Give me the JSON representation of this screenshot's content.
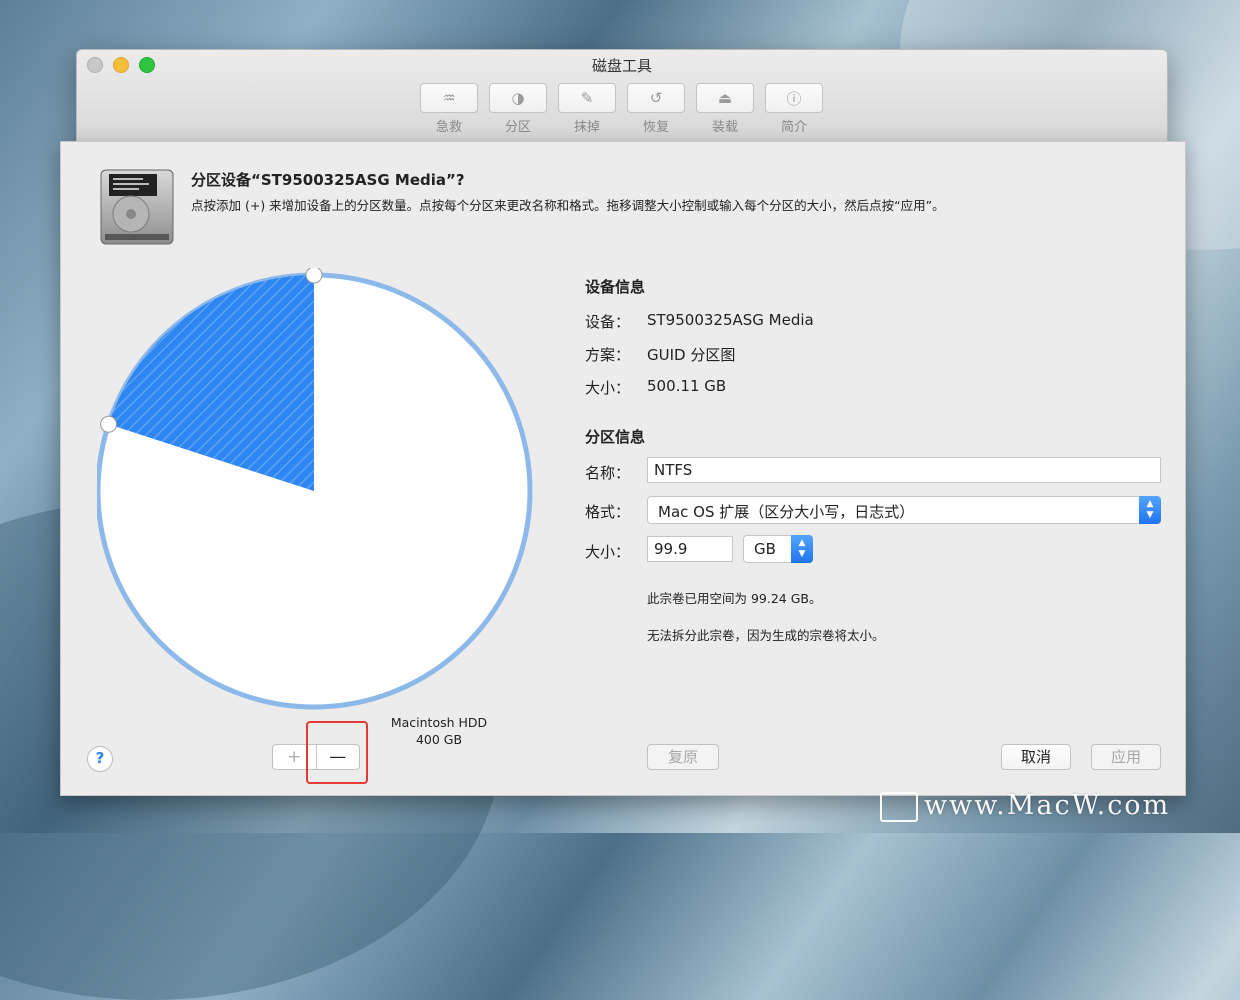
{
  "window": {
    "title": "磁盘工具"
  },
  "toolbar": [
    {
      "label": "急救",
      "icon": "stethoscope-icon",
      "glyph": "♒"
    },
    {
      "label": "分区",
      "icon": "partition-icon",
      "glyph": "◑"
    },
    {
      "label": "抹掉",
      "icon": "erase-icon",
      "glyph": "✎"
    },
    {
      "label": "恢复",
      "icon": "restore-icon",
      "glyph": "↺"
    },
    {
      "label": "装载",
      "icon": "mount-icon",
      "glyph": "⏏"
    },
    {
      "label": "简介",
      "icon": "info-icon",
      "glyph": "ⓘ"
    }
  ],
  "sheet": {
    "title": "分区设备“ST9500325ASG Media”?",
    "description": "点按添加 (+) 来增加设备上的分区数量。点按每个分区来更改名称和格式。拖移调整大小控制或输入每个分区的大小，然后点按“应用”。"
  },
  "pie": {
    "partitions": [
      {
        "name": "NTFS",
        "size": "99.9 GB",
        "color": "#2e86f2"
      },
      {
        "name": "Macintosh HDD",
        "size": "400 GB",
        "color": "#ffffff"
      }
    ],
    "ntfs_fraction": 0.2,
    "border_color": "#8cb9ea"
  },
  "device_info": {
    "title": "设备信息",
    "device_label": "设备：",
    "device_value": "ST9500325ASG Media",
    "scheme_label": "方案：",
    "scheme_value": "GUID 分区图",
    "size_label": "大小：",
    "size_value": "500.11 GB"
  },
  "partition_info": {
    "title": "分区信息",
    "name_label": "名称：",
    "name_value": "NTFS",
    "format_label": "格式：",
    "format_value": "Mac OS 扩展（区分大小写，日志式）",
    "size_label": "大小：",
    "size_value": "99.9",
    "unit_value": "GB",
    "note1": "此宗卷已用空间为 99.24 GB。",
    "note2": "无法拆分此宗卷，因为生成的宗卷将太小。"
  },
  "buttons": {
    "help": "?",
    "add": "+",
    "remove": "—",
    "revert": "复原",
    "cancel": "取消",
    "apply": "应用"
  },
  "watermark": "www.MacW.com"
}
